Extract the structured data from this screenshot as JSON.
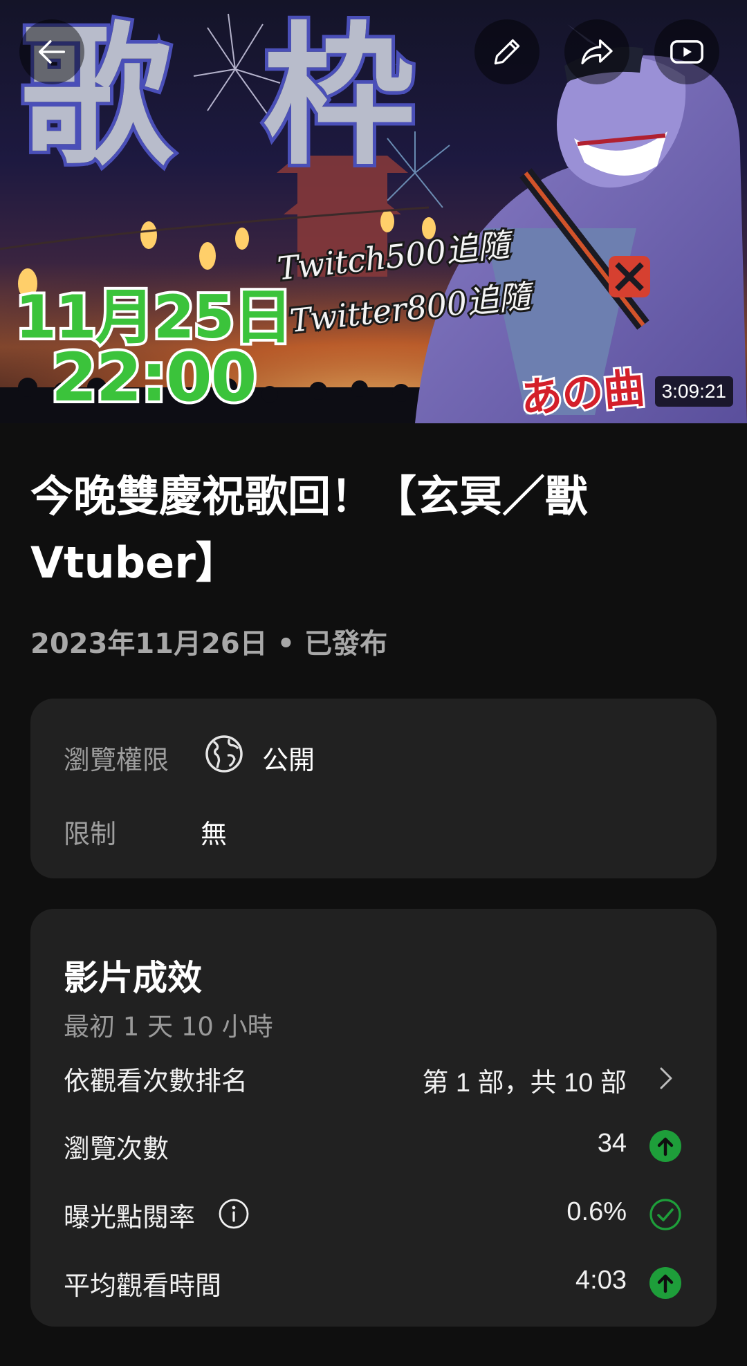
{
  "thumbnail": {
    "title_left": "歌",
    "title_right": "枠",
    "date_line1": "11月25日",
    "date_line2": "22:00",
    "follow_line1": "Twitch500追隨",
    "follow_line2": "Twitter800追隨",
    "song_text": "あの曲",
    "duration": "3:09:21"
  },
  "toolbar": {
    "back": "arrow-left-icon",
    "edit": "pencil-icon",
    "share": "share-icon",
    "open_youtube": "youtube-icon"
  },
  "video": {
    "title": "今晚雙慶祝歌回！【玄冥／獸Vtuber】",
    "publish_info": "2023年11月26日 • 已發布"
  },
  "visibility_card": {
    "visibility_label": "瀏覽權限",
    "visibility_icon": "globe-icon",
    "visibility_value": "公開",
    "restriction_label": "限制",
    "restriction_value": "無"
  },
  "performance": {
    "title": "影片成效",
    "period": "最初 1 天 10 小時",
    "rows": [
      {
        "label": "依觀看次數排名",
        "value": "第 1 部，共 10 部",
        "icon": "chevron-right-icon"
      },
      {
        "label": "瀏覽次數",
        "value": "34",
        "icon": "arrow-up-circle-icon"
      },
      {
        "label": "曝光點閱率",
        "value": "0.6%",
        "icon": "check-circle-icon",
        "info_icon": "info-icon"
      },
      {
        "label": "平均觀看時間",
        "value": "4:03",
        "icon": "arrow-up-circle-icon"
      }
    ]
  },
  "colors": {
    "background": "#0f0f0f",
    "card": "#212121",
    "positive_green": "#1e9e3a",
    "secondary_text": "#a8a8a8"
  }
}
